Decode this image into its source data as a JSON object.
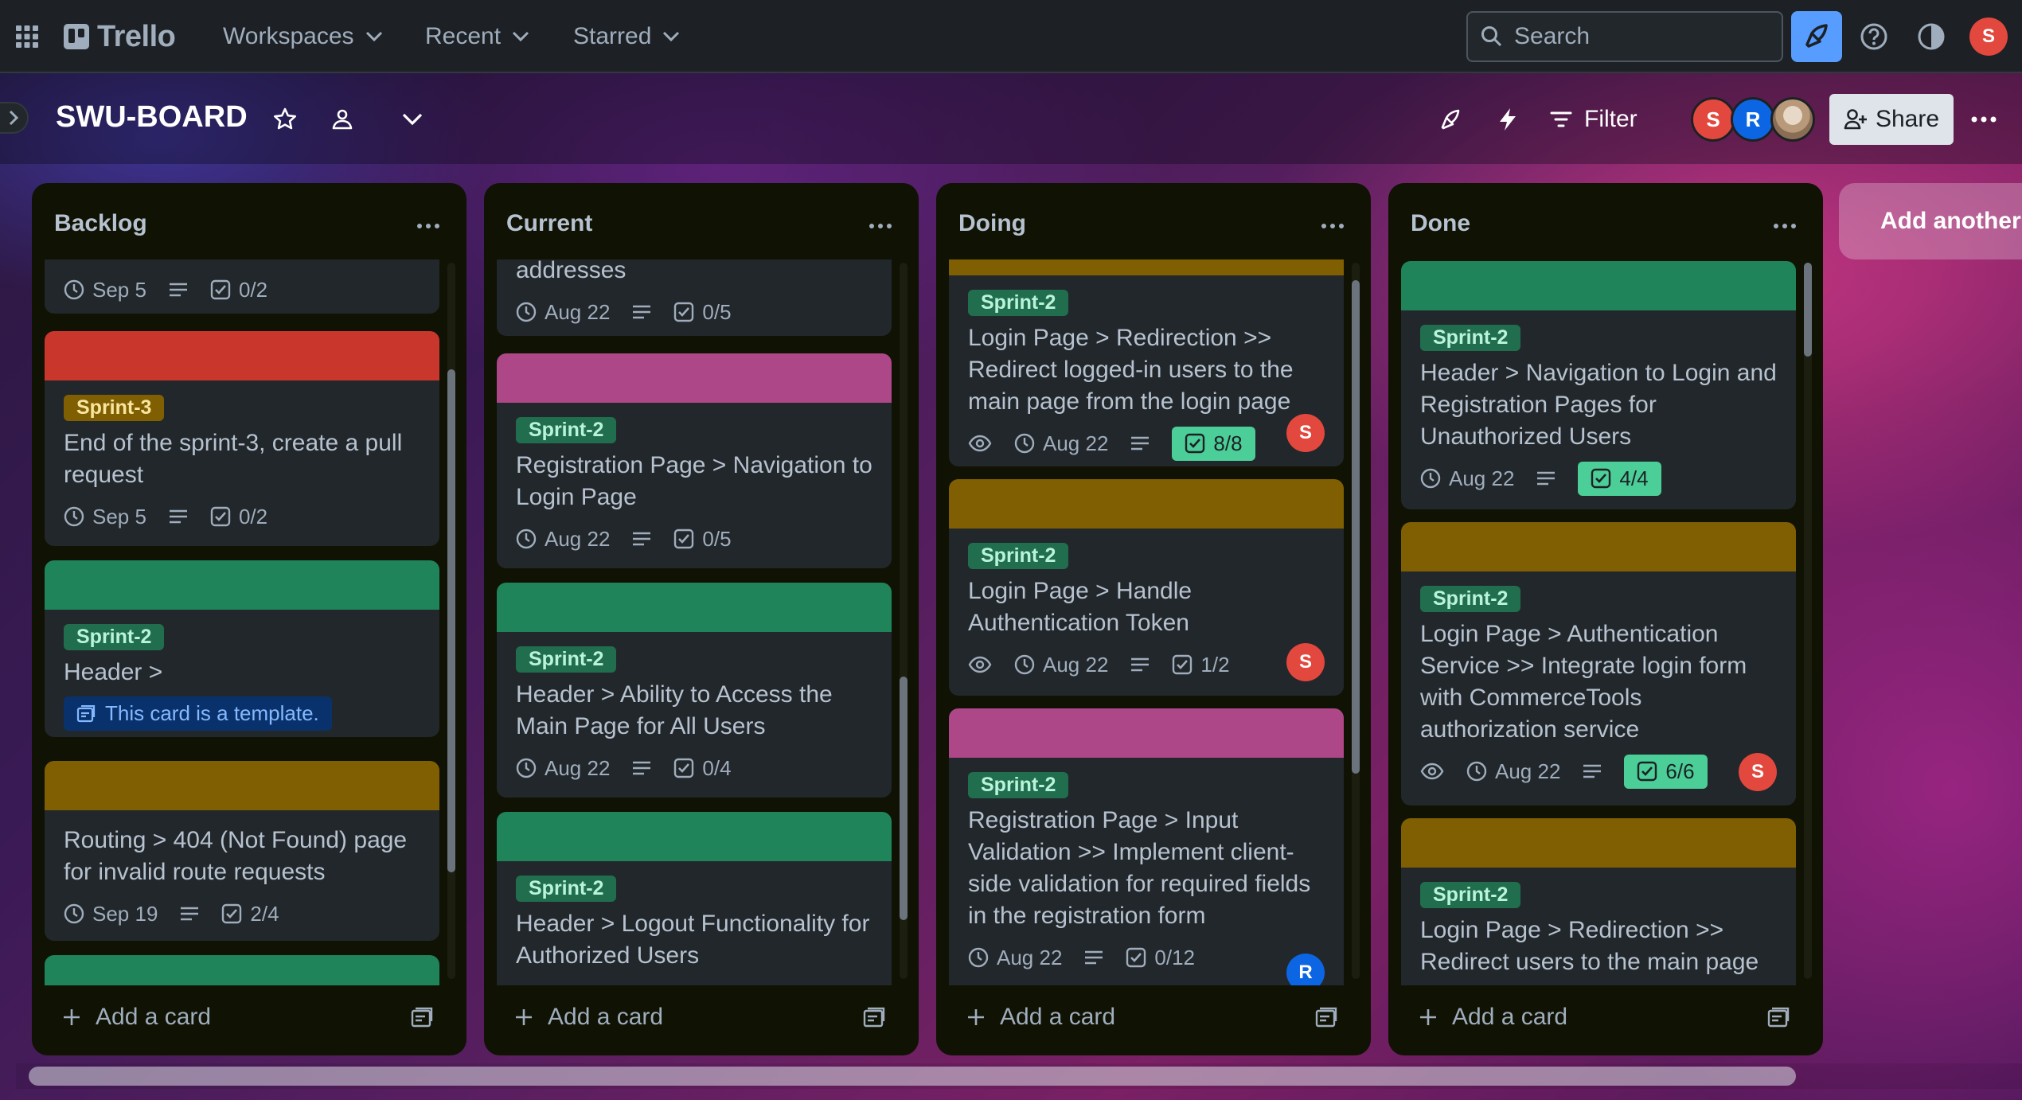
{
  "nav": {
    "logo": "Trello",
    "menus": [
      "Workspaces",
      "Recent",
      "Starred"
    ],
    "search_placeholder": "Search",
    "user_initial": "S"
  },
  "board": {
    "title": "SWU-BOARD",
    "filter_label": "Filter",
    "share_label": "Share",
    "members": [
      "S",
      "R"
    ]
  },
  "colors": {
    "green": "#1f845a",
    "red": "#c9372c",
    "purple": "#ae4787",
    "olive": "#7f5f01",
    "label_green_bg": "#216e4e",
    "label_green_fg": "#baf3db",
    "label_yellow_bg": "#7f5f01",
    "label_yellow_fg": "#f8e6a0",
    "avatar_red": "#e2483d",
    "avatar_blue": "#0c66e4"
  },
  "add_card_label": "Add a card",
  "add_list_label": "Add another list",
  "lists": [
    {
      "name": "Backlog",
      "cards": [
        {
          "date": "Sep 5",
          "checklist": "0/2"
        },
        {
          "label": "Sprint-3",
          "title": "End of the sprint-3, create a pull request",
          "date": "Sep 5",
          "checklist": "0/2"
        },
        {
          "label": "Sprint-2",
          "title": "Header >",
          "template_note": "This card is a template."
        },
        {
          "title": "Routing > 404 (Not Found) page for invalid route requests",
          "date": "Sep 19",
          "checklist": "2/4"
        }
      ]
    },
    {
      "name": "Current",
      "cards": [
        {
          "title": "addresses",
          "date": "Aug 22",
          "checklist": "0/5"
        },
        {
          "label": "Sprint-2",
          "title": "Registration Page > Navigation to Login Page",
          "date": "Aug 22",
          "checklist": "0/5"
        },
        {
          "label": "Sprint-2",
          "title": "Header > Ability to Access the Main Page for All Users",
          "date": "Aug 22",
          "checklist": "0/4"
        },
        {
          "label": "Sprint-2",
          "title": "Header > Logout Functionality for Authorized Users"
        }
      ]
    },
    {
      "name": "Doing",
      "cards": [
        {
          "label": "Sprint-2",
          "title": "Login Page > Redirection >> Redirect logged-in users to the main page from the login page",
          "date": "Aug 22",
          "checklist": "8/8",
          "member": "S"
        },
        {
          "label": "Sprint-2",
          "title": "Login Page > Handle Authentication Token",
          "date": "Aug 22",
          "checklist": "1/2",
          "member": "S"
        },
        {
          "label": "Sprint-2",
          "title": "Registration Page > Input Validation >> Implement client-side validation for required fields in the registration form",
          "date": "Aug 22",
          "checklist": "0/12",
          "member": "R"
        }
      ]
    },
    {
      "name": "Done",
      "cards": [
        {
          "label": "Sprint-2",
          "title": "Header > Navigation to Login and Registration Pages for Unauthorized Users",
          "date": "Aug 22",
          "checklist": "4/4"
        },
        {
          "label": "Sprint-2",
          "title": "Login Page > Authentication Service >> Integrate login form with CommerceTools authorization service",
          "date": "Aug 22",
          "checklist": "6/6",
          "member": "S"
        },
        {
          "label": "Sprint-2",
          "title": "Login Page > Redirection >> Redirect users to the main page"
        }
      ]
    }
  ]
}
